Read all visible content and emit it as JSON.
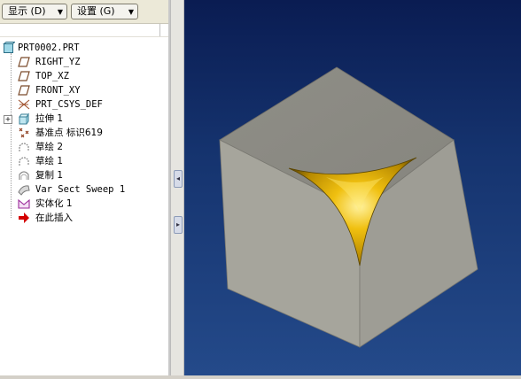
{
  "toolbar": {
    "display_label": "显示 (D)",
    "settings_label": "设置 (G)"
  },
  "tree": {
    "items": [
      {
        "label": "PRT0002.PRT",
        "icon": "part-icon"
      },
      {
        "label": "RIGHT_YZ",
        "icon": "datum-plane-icon"
      },
      {
        "label": "TOP_XZ",
        "icon": "datum-plane-icon"
      },
      {
        "label": "FRONT_XY",
        "icon": "datum-plane-icon"
      },
      {
        "label": "PRT_CSYS_DEF",
        "icon": "coordinate-system-icon"
      },
      {
        "label": "拉伸 1",
        "icon": "extrude-icon"
      },
      {
        "label": "基准点 标识619",
        "icon": "datum-point-icon"
      },
      {
        "label": "草绘 2",
        "icon": "sketch-icon"
      },
      {
        "label": "草绘 1",
        "icon": "sketch-icon"
      },
      {
        "label": "复制 1",
        "icon": "copy-icon"
      },
      {
        "label": "Var Sect Sweep 1",
        "icon": "sweep-icon"
      },
      {
        "label": "实体化 1",
        "icon": "solidify-icon"
      },
      {
        "label": "在此插入",
        "icon": "insert-here-arrow-icon"
      }
    ]
  },
  "colors": {
    "viewport_top": "#0a1c52",
    "viewport_bottom": "#244a8a",
    "cube_face": "#a8a79e",
    "surface_gold": "#e0b010",
    "insert_arrow": "#cc0000"
  }
}
